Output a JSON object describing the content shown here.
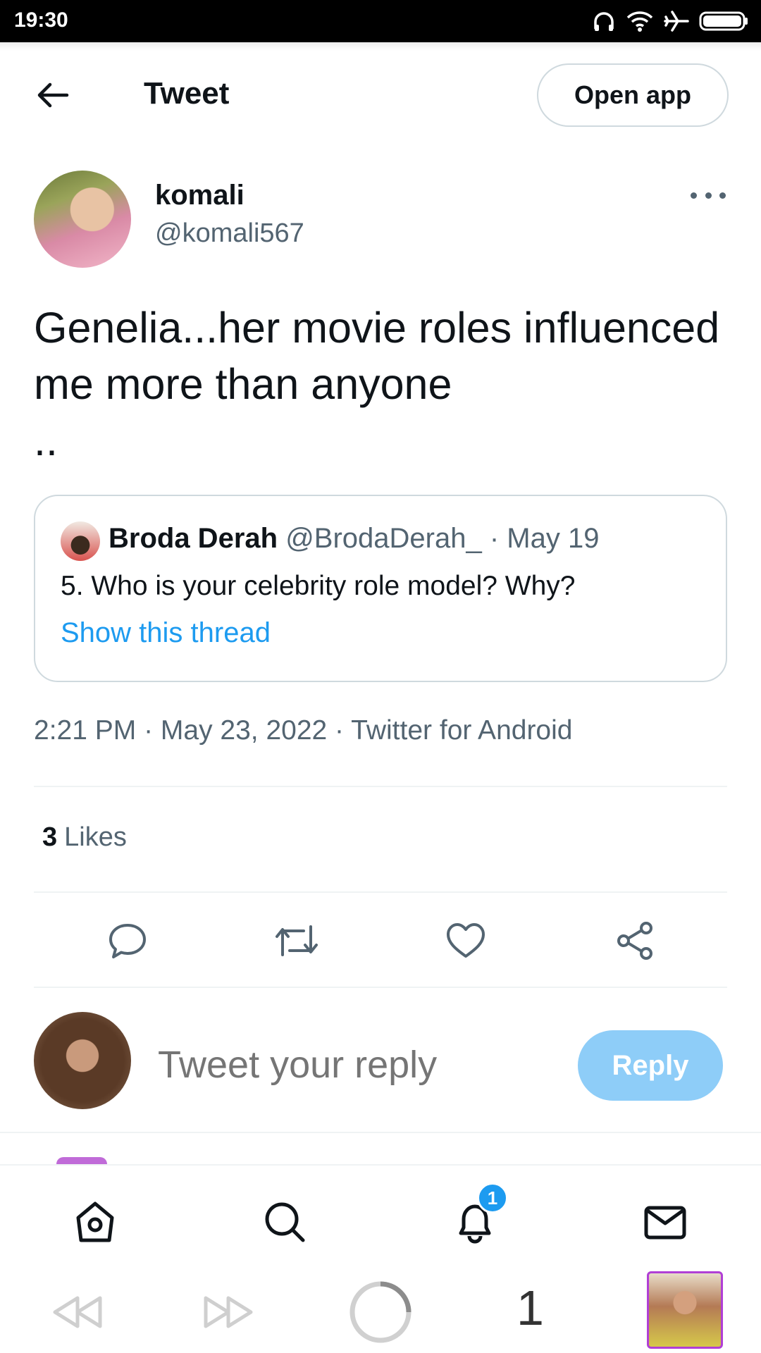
{
  "status_bar": {
    "time": "19:30"
  },
  "header": {
    "title": "Tweet",
    "open_app_label": "Open app"
  },
  "tweet": {
    "author_name": "komali",
    "author_handle": "@komali567",
    "text": "Genelia...her movie roles influenced me more than anyone\n..",
    "timestamp": "2:21 PM · May 23, 2022 · Twitter for Android",
    "likes_count": "3",
    "likes_label": "Likes"
  },
  "quote": {
    "author_name": "Broda Derah",
    "author_meta": "@BrodaDerah_ · May 19",
    "text": "5. Who is your celebrity role model? Why?",
    "link_label": "Show this thread"
  },
  "reply": {
    "placeholder": "Tweet your reply",
    "button_label": "Reply"
  },
  "bottom_nav": {
    "notification_badge": "1"
  },
  "browser_bar": {
    "tab_count": "1"
  },
  "colors": {
    "accent": "#1d9bf0",
    "reply_button_disabled": "#8ecdf8",
    "secondary_text": "#536471"
  }
}
